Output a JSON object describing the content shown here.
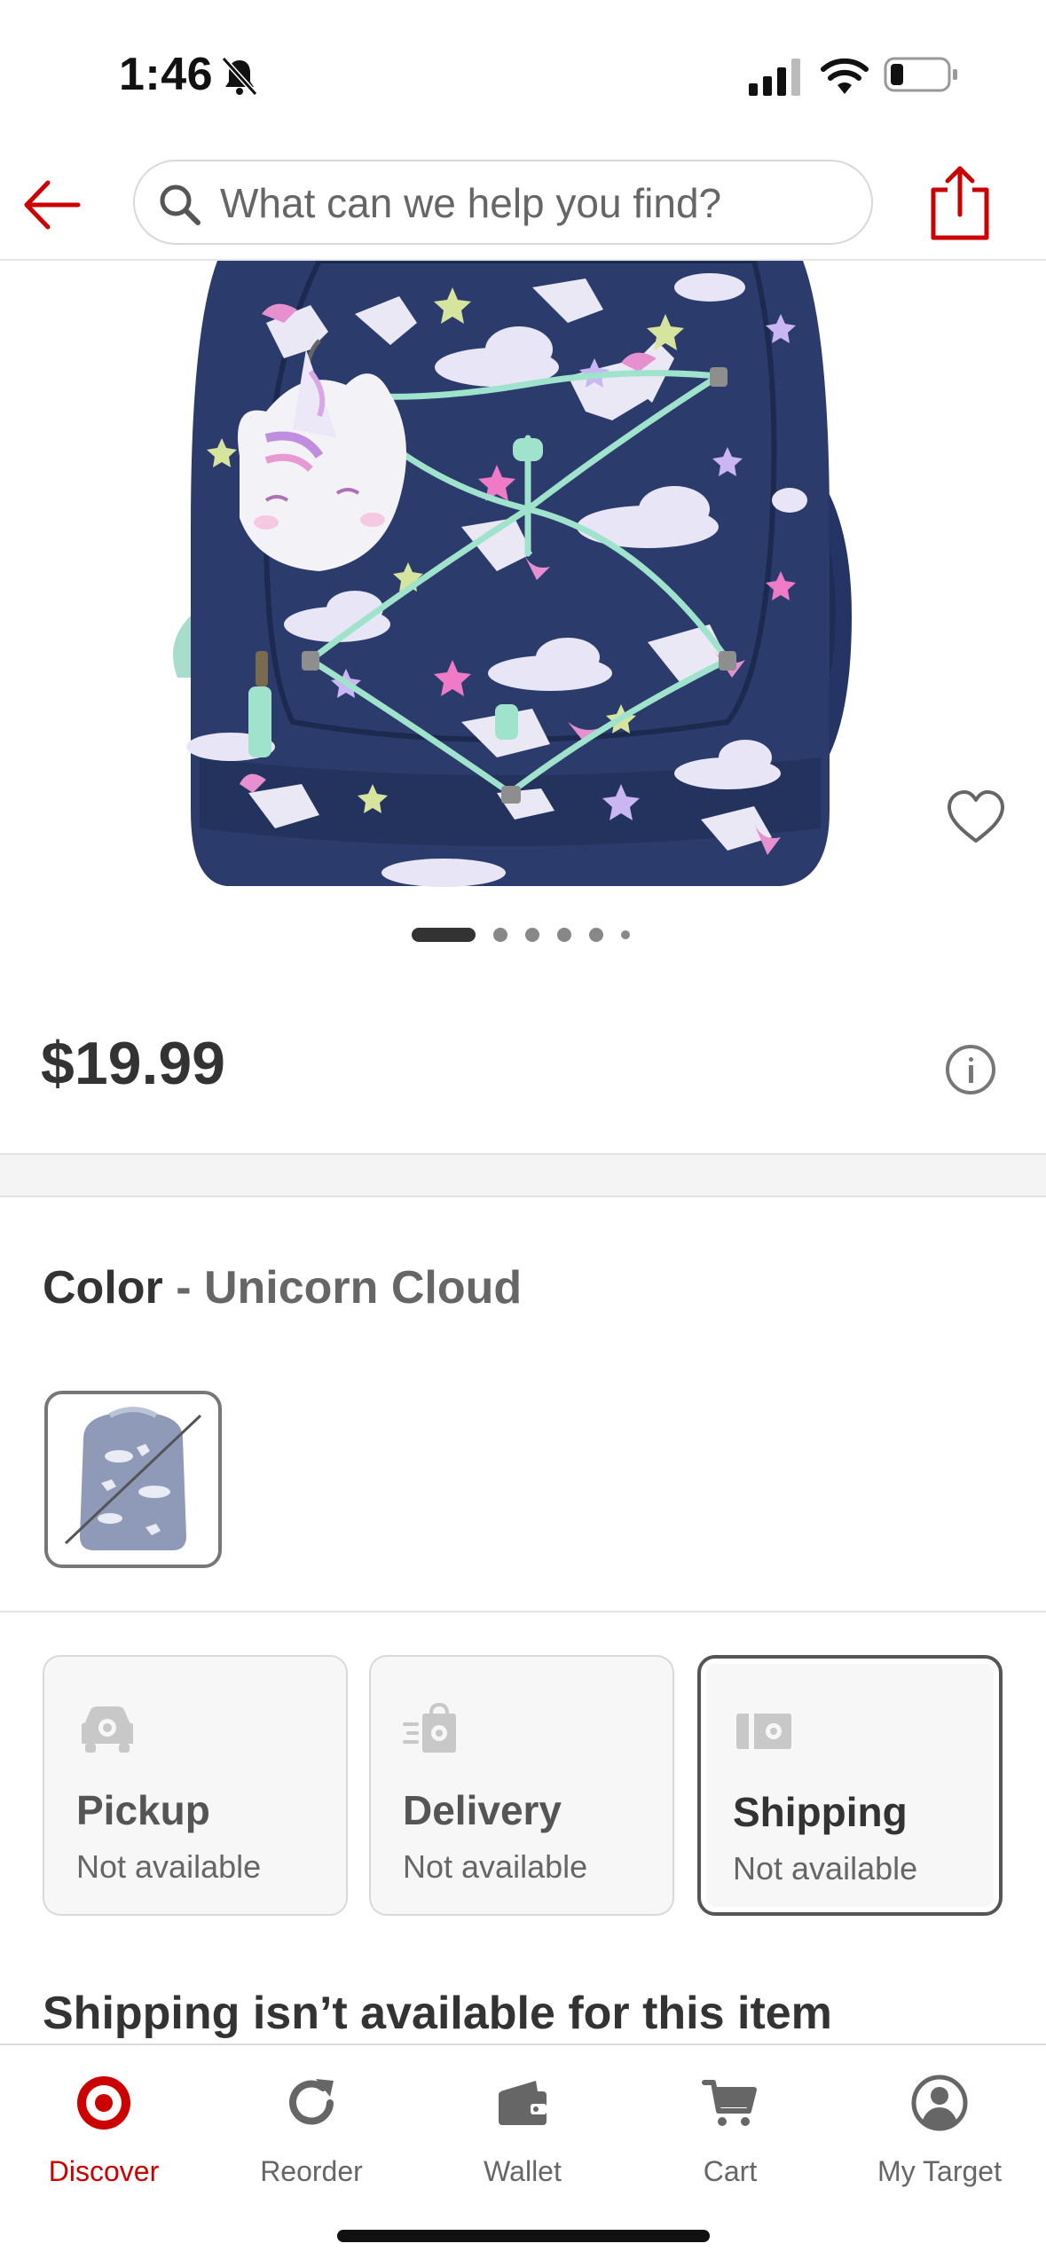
{
  "status_bar": {
    "time": "1:46"
  },
  "header": {
    "search_placeholder": "What can we help you find?"
  },
  "product": {
    "image_alt": "Unicorn Cloud backpack",
    "image_index": 1,
    "image_count": 6,
    "price": "$19.99"
  },
  "color": {
    "label": "Color",
    "separator": " - ",
    "selected": "Unicorn Cloud"
  },
  "fulfillment": {
    "options": [
      {
        "title": "Pickup",
        "status": "Not available"
      },
      {
        "title": "Delivery",
        "status": "Not available"
      },
      {
        "title": "Shipping",
        "status": "Not available"
      }
    ],
    "selected": "Shipping",
    "message": "Shipping isn’t available for this item"
  },
  "nav": {
    "items": [
      {
        "label": "Discover",
        "icon": "target-logo-icon"
      },
      {
        "label": "Reorder",
        "icon": "reorder-icon"
      },
      {
        "label": "Wallet",
        "icon": "wallet-icon"
      },
      {
        "label": "Cart",
        "icon": "cart-icon"
      },
      {
        "label": "My Target",
        "icon": "account-icon"
      }
    ],
    "active": "Discover"
  },
  "colors": {
    "brand_red": "#cc0000",
    "text_dark": "#333333",
    "backpack_navy": "#2b3b6b"
  }
}
